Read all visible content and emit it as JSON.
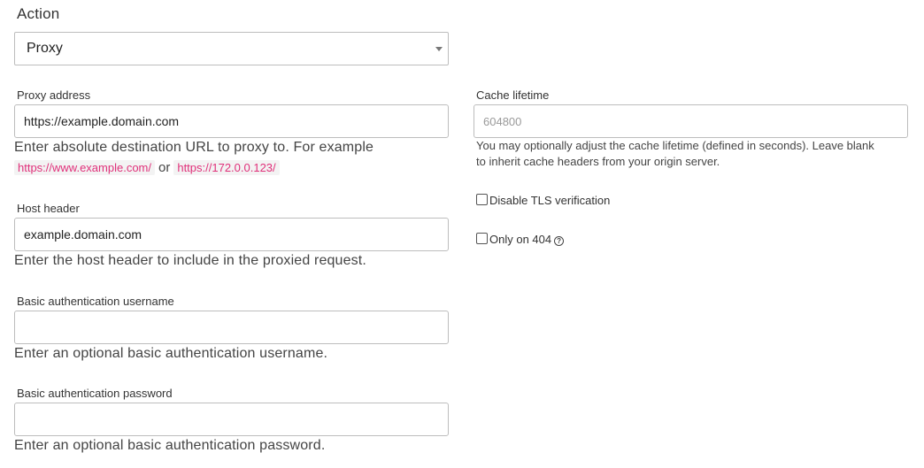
{
  "action": {
    "label": "Action",
    "selected": "Proxy"
  },
  "proxy_address": {
    "label": "Proxy address",
    "value": "https://example.domain.com",
    "help_text": "Enter absolute destination URL to proxy to. For example",
    "example_1": "https://www.example.com/",
    "or_text": "or",
    "example_2": "https://172.0.0.123/"
  },
  "host_header": {
    "label": "Host header",
    "value": "example.domain.com",
    "help_text": "Enter the host header to include in the proxied request."
  },
  "basic_auth_username": {
    "label": "Basic authentication username",
    "value": "",
    "help_text": "Enter an optional basic authentication username."
  },
  "basic_auth_password": {
    "label": "Basic authentication password",
    "value": "",
    "help_text": "Enter an optional basic authentication password."
  },
  "cache_lifetime": {
    "label": "Cache lifetime",
    "value": "",
    "placeholder": "604800",
    "help_line_1": "You may optionally adjust the cache lifetime (defined in seconds). Leave blank",
    "help_line_2": "to inherit cache headers from your origin server."
  },
  "disable_tls": {
    "label": "Disable TLS verification",
    "checked": false
  },
  "only_on_404": {
    "label": "Only on 404",
    "checked": false,
    "help_icon": "question-circle-icon",
    "help_icon_glyph": "?"
  }
}
